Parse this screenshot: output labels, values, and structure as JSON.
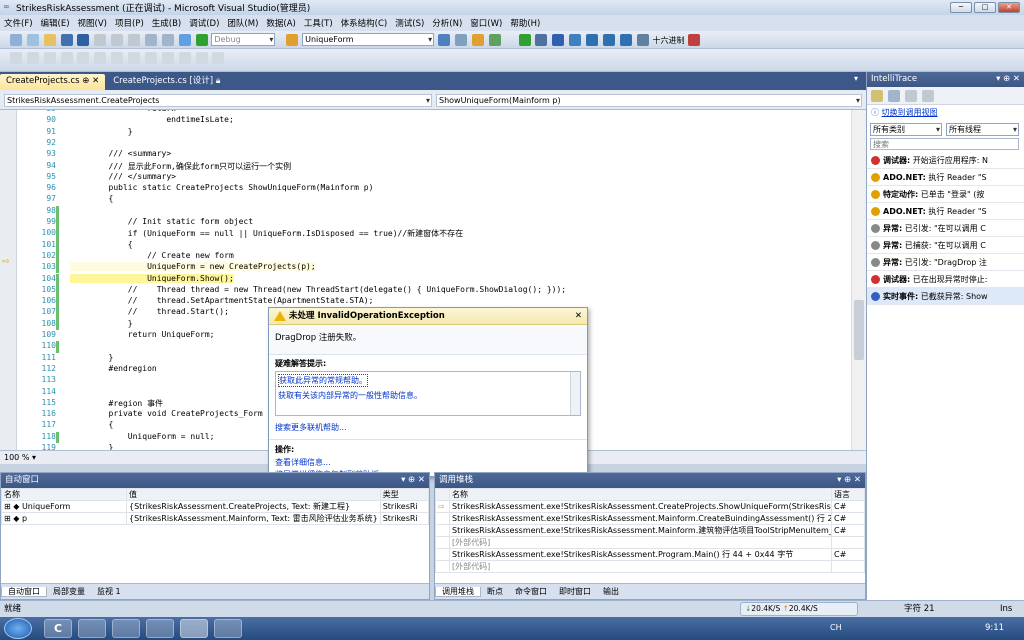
{
  "window": {
    "title": "StrikesRiskAssessment (正在调试) - Microsoft Visual Studio(管理员)",
    "min": "─",
    "max": "□",
    "close": "✕"
  },
  "menu": [
    "文件(F)",
    "编辑(E)",
    "视图(V)",
    "项目(P)",
    "生成(B)",
    "调试(D)",
    "团队(M)",
    "数据(A)",
    "工具(T)",
    "体系结构(C)",
    "测试(S)",
    "分析(N)",
    "窗口(W)",
    "帮助(H)"
  ],
  "toolbar": {
    "config": "Debug",
    "find": "UniqueForm",
    "hex_label": "十六进制"
  },
  "tabs": [
    {
      "label": "CreateProjects.cs",
      "active": true
    },
    {
      "label": "CreateProjects.cs [设计]",
      "active": false
    }
  ],
  "nav": {
    "left": "StrikesRiskAssessment.CreateProjects",
    "right": "ShowUniqueForm(Mainform p)"
  },
  "editor": {
    "zoom": "100 %",
    "lines": [
      {
        "n": "89",
        "t": "                return"
      },
      {
        "n": "90",
        "t": "                    endtimeIsLate;"
      },
      {
        "n": "91",
        "t": "            }"
      },
      {
        "n": "92",
        "t": ""
      },
      {
        "n": "93",
        "t": "        /// <summary>"
      },
      {
        "n": "94",
        "t": "        /// 显示此Form,确保此form只可以运行一个实例"
      },
      {
        "n": "95",
        "t": "        /// </summary>"
      },
      {
        "n": "96",
        "t": "        public static CreateProjects ShowUniqueForm(Mainform p)"
      },
      {
        "n": "97",
        "t": "        {"
      },
      {
        "n": "98",
        "t": ""
      },
      {
        "n": "99",
        "t": "            // Init static form object"
      },
      {
        "n": "100",
        "t": "            if (UniqueForm == null || UniqueForm.IsDisposed == true)//新建窗体不存在"
      },
      {
        "n": "101",
        "t": "            {"
      },
      {
        "n": "102",
        "t": "                // Create new form"
      },
      {
        "n": "103",
        "t": "                UniqueForm = new CreateProjects(p);"
      },
      {
        "n": "104",
        "t": "                UniqueForm.Show();"
      },
      {
        "n": "105",
        "t": "            //    Thread thread = new Thread(new ThreadStart(delegate() { UniqueForm.ShowDialog(); }));"
      },
      {
        "n": "106",
        "t": "            //    thread.SetApartmentState(ApartmentState.STA);"
      },
      {
        "n": "107",
        "t": "            //    thread.Start();"
      },
      {
        "n": "108",
        "t": "            }"
      },
      {
        "n": "109",
        "t": "            return UniqueForm;"
      },
      {
        "n": "110",
        "t": ""
      },
      {
        "n": "111",
        "t": "        }"
      },
      {
        "n": "112",
        "t": "        #endregion"
      },
      {
        "n": "113",
        "t": ""
      },
      {
        "n": "114",
        "t": ""
      },
      {
        "n": "115",
        "t": "        #region 事件"
      },
      {
        "n": "116",
        "t": "        private void CreateProjects_Form"
      },
      {
        "n": "117",
        "t": "        {"
      },
      {
        "n": "118",
        "t": "            UniqueForm = null;"
      },
      {
        "n": "119",
        "t": "        }"
      }
    ]
  },
  "exception": {
    "title": "未处理 InvalidOperationException",
    "message": "DragDrop 注册失败。",
    "tips_label": "疑难解答提示:",
    "tip1": "获取此异常的常规帮助。",
    "tip2": "获取有关该内部异常的一般性帮助信息。",
    "search": "搜索更多联机帮助...",
    "actions_label": "操作:",
    "action1": "查看详细信息...",
    "action2": "将异常详细信息复制到剪贴板",
    "close": "✕"
  },
  "intellitrace": {
    "title": "IntelliTrace",
    "switch_link": "切换到调用视图",
    "filter1": "所有类别",
    "filter2": "所有线程",
    "search_placeholder": "搜索",
    "events": [
      {
        "label": "调试器:",
        "text": "开始运行应用程序: N",
        "color": "#d03030"
      },
      {
        "label": "ADO.NET:",
        "text": "执行 Reader \"S",
        "color": "#e0a000"
      },
      {
        "label": "特定动作:",
        "text": "已单击 \"登录\" (按",
        "color": "#e0a000"
      },
      {
        "label": "ADO.NET:",
        "text": "执行 Reader \"S",
        "color": "#e0a000"
      },
      {
        "label": "异常:",
        "text": "已引发: \"在可以调用 C",
        "color": "#888888"
      },
      {
        "label": "异常:",
        "text": "已捕获: \"在可以调用 C",
        "color": "#888888"
      },
      {
        "label": "异常:",
        "text": "已引发: \"DragDrop 注",
        "color": "#888888"
      },
      {
        "label": "调试器:",
        "text": "已在出现异常时停止:",
        "color": "#d03030"
      },
      {
        "label": "实时事件:",
        "text": "已截获异常: Show",
        "color": "#3060c0"
      }
    ]
  },
  "autos": {
    "title": "自动窗口",
    "cols": [
      "名称",
      "值",
      "类型"
    ],
    "rows": [
      {
        "name": "UniqueForm",
        "value": "{StrikesRiskAssessment.CreateProjects, Text: 新建工程}",
        "type": "StrikesRi"
      },
      {
        "name": "p",
        "value": "{StrikesRiskAssessment.Mainform, Text: 雷击风险评估业务系统}",
        "type": "StrikesRi"
      }
    ],
    "tabs": [
      "自动窗口",
      "局部变量",
      "监视 1"
    ]
  },
  "callstack": {
    "title": "调用堆栈",
    "cols": [
      "名称",
      "语言"
    ],
    "rows": [
      {
        "name": "StrikesRiskAssessment.exe!StrikesRiskAssessment.CreateProjects.ShowUniqueForm(StrikesRiskAssessm",
        "lang": "C#"
      },
      {
        "name": "StrikesRiskAssessment.exe!StrikesRiskAssessment.Mainform.CreateBuindingAssessment() 行 221 + 0x1",
        "lang": "C#"
      },
      {
        "name": "StrikesRiskAssessment.exe!StrikesRiskAssessment.Mainform.建筑物评估项目ToolStripMenuItem_Click",
        "lang": "C#"
      },
      {
        "name": "[外部代码]",
        "lang": ""
      },
      {
        "name": "StrikesRiskAssessment.exe!StrikesRiskAssessment.Program.Main() 行 44 + 0x44 字节",
        "lang": "C#"
      },
      {
        "name": "[外部代码]",
        "lang": ""
      }
    ],
    "tabs": [
      "调用堆栈",
      "断点",
      "命令窗口",
      "即时窗口",
      "输出"
    ]
  },
  "status": {
    "left": "就绪",
    "col": "字符 21",
    "mode": "Ins",
    "down": "20.4K/S",
    "up": "20.4K/S"
  },
  "tray": {
    "lang": "CH",
    "time": "9:11"
  }
}
